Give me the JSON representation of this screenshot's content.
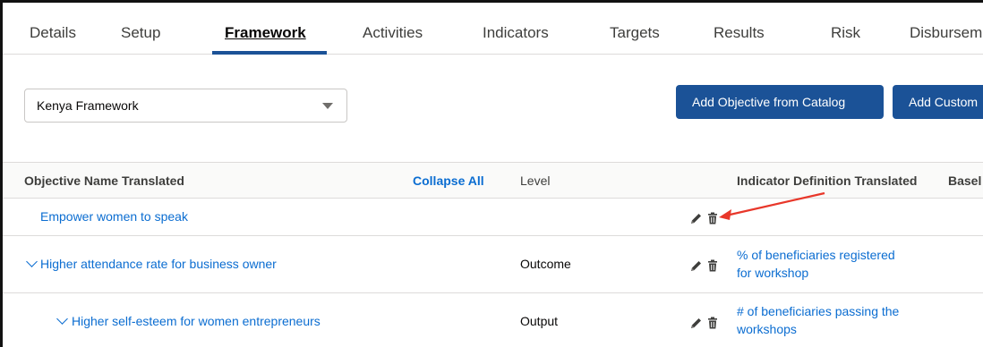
{
  "tabs": [
    {
      "label": "Details",
      "active": false
    },
    {
      "label": "Setup",
      "active": false
    },
    {
      "label": "Framework",
      "active": true
    },
    {
      "label": "Activities",
      "active": false
    },
    {
      "label": "Indicators",
      "active": false
    },
    {
      "label": "Targets",
      "active": false
    },
    {
      "label": "Results",
      "active": false
    },
    {
      "label": "Risk",
      "active": false
    },
    {
      "label": "Disburseme",
      "active": false
    }
  ],
  "framework_select": {
    "value": "Kenya Framework"
  },
  "buttons": {
    "add_from_catalog": "Add Objective from Catalog",
    "add_custom": "Add Custom"
  },
  "table": {
    "headers": {
      "objective": "Objective Name Translated",
      "collapse_all": "Collapse All",
      "level": "Level",
      "indicator": "Indicator Definition Translated",
      "baseline": "Basel"
    },
    "rows": [
      {
        "objective": "Empower women to speak",
        "level": "",
        "indicator_line1": "",
        "indicator_line2": "",
        "expandable": false
      },
      {
        "objective": "Higher attendance rate for business owner",
        "level": "Outcome",
        "indicator_line1": "% of beneficiaries registered",
        "indicator_line2": "for workshop",
        "expandable": true
      },
      {
        "objective": "Higher self-esteem for women entrepreneurs",
        "level": "Output",
        "indicator_line1": "# of beneficiaries passing the",
        "indicator_line2": "workshops",
        "expandable": true
      }
    ]
  },
  "colors": {
    "brand": "#1b5297",
    "link": "#0b6dd1",
    "annotation_arrow": "#e8372a"
  },
  "icons": [
    "pencil-icon",
    "trash-icon",
    "chevron-down-icon",
    "caret-down-icon"
  ]
}
